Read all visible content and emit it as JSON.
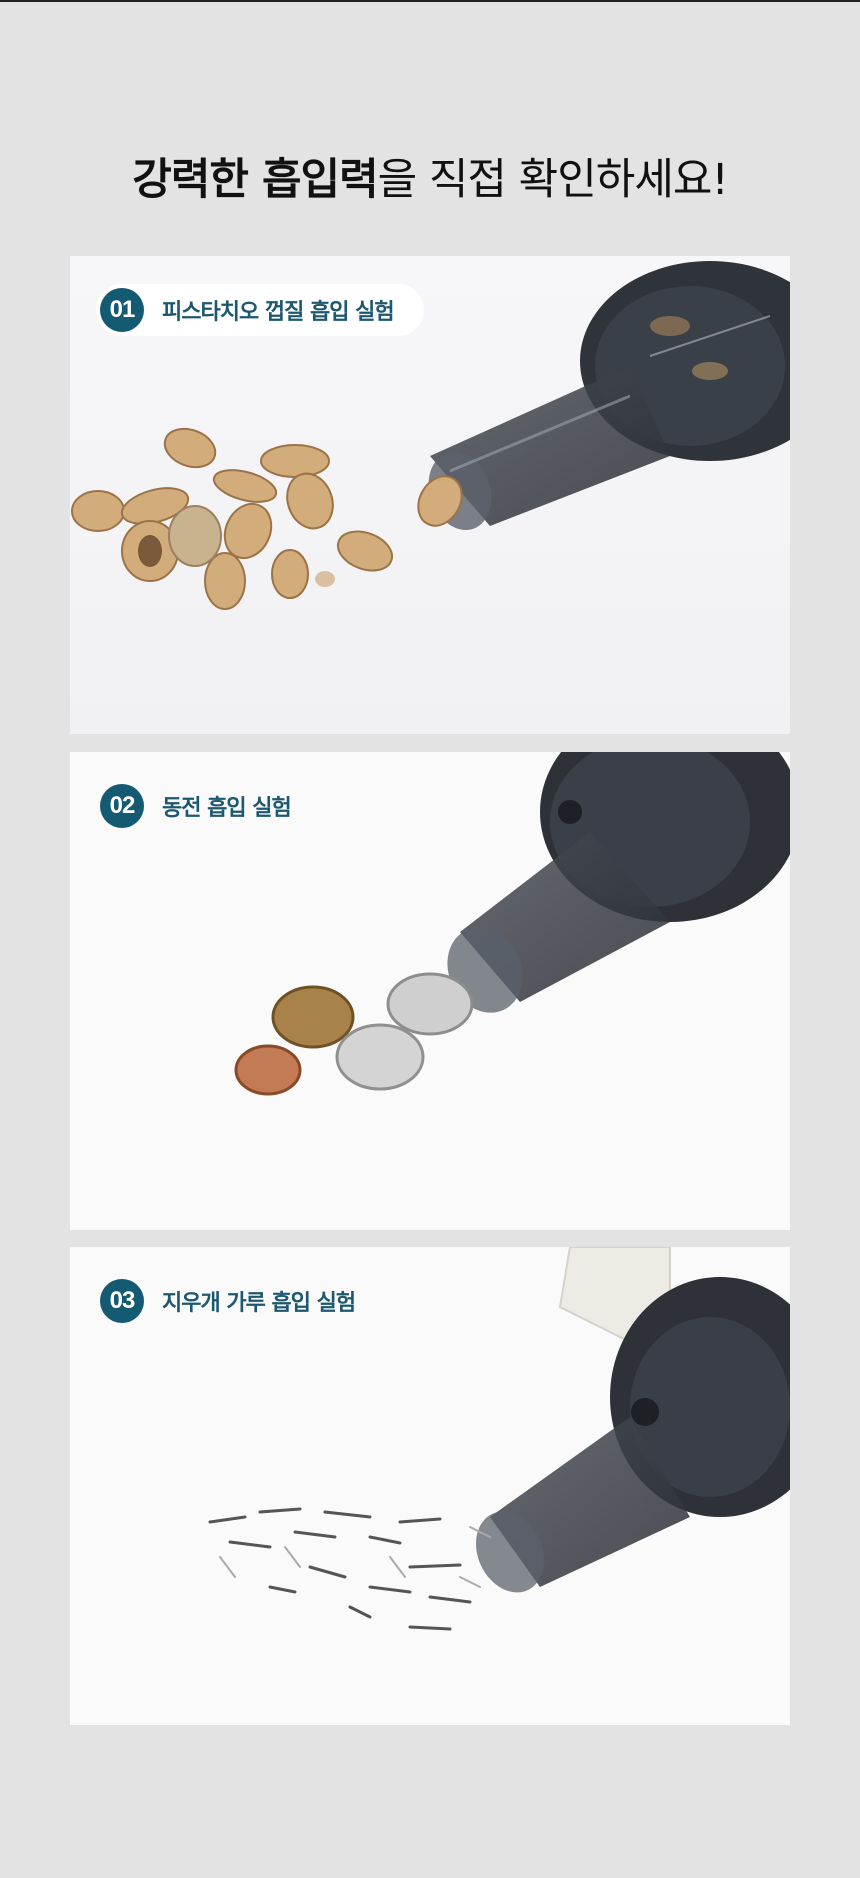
{
  "headline": {
    "bold": "강력한 흡입력",
    "regular": "을 직접 확인하세요!"
  },
  "experiments": [
    {
      "number": "01",
      "label": "피스타치오 껍질 흡입 실험"
    },
    {
      "number": "02",
      "label": "동전 흡입 실험"
    },
    {
      "number": "03",
      "label": "지우개 가루 흡입 실험"
    }
  ],
  "colors": {
    "background": "#e3e3e3",
    "accent": "#155a73",
    "label_text": "#1c5870"
  }
}
